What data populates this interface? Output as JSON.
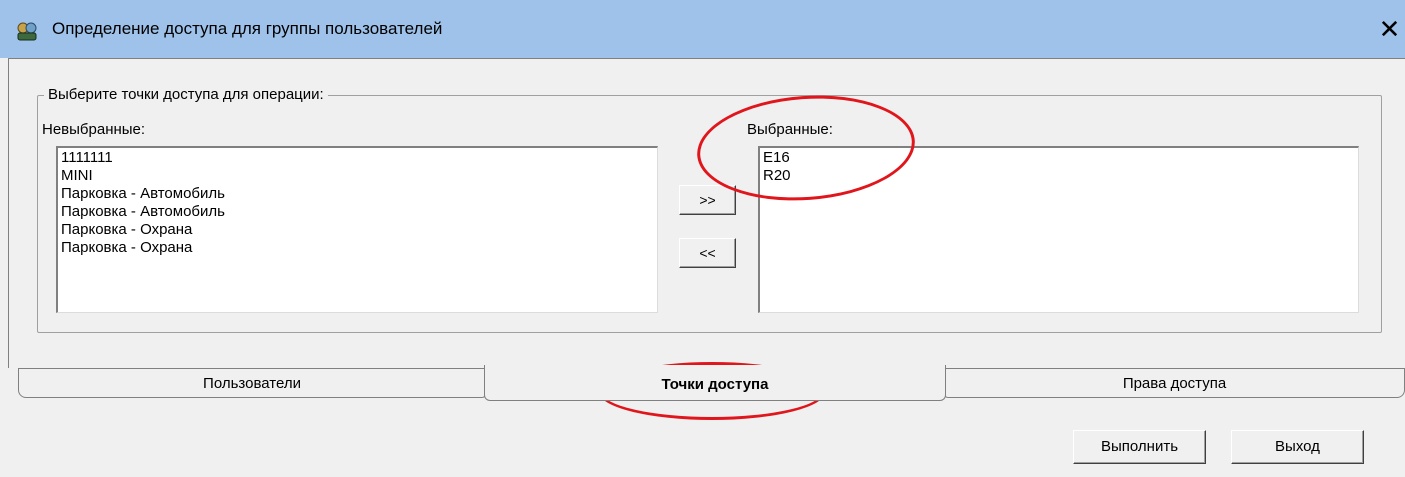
{
  "window": {
    "title": "Определение доступа для группы пользователей",
    "close_label": "✕"
  },
  "groupbox": {
    "legend": "Выберите точки доступа для операции:"
  },
  "unselected": {
    "label": "Невыбранные:",
    "items": [
      "1111111",
      "MINI",
      "Парковка - Автомобиль",
      "Парковка - Автомобиль",
      "Парковка - Охрана",
      "Парковка - Охрана"
    ]
  },
  "selected": {
    "label": "Выбранные:",
    "items": [
      "E16",
      "R20"
    ]
  },
  "buttons": {
    "add": ">>",
    "remove": "<<",
    "execute": "Выполнить",
    "exit": "Выход"
  },
  "tabs": [
    {
      "label": "Пользователи",
      "active": false
    },
    {
      "label": "Точки доступа",
      "active": true
    },
    {
      "label": "Права доступа",
      "active": false
    }
  ],
  "colors": {
    "titlebar": "#9ec2ea",
    "annotation": "#e0161c"
  }
}
